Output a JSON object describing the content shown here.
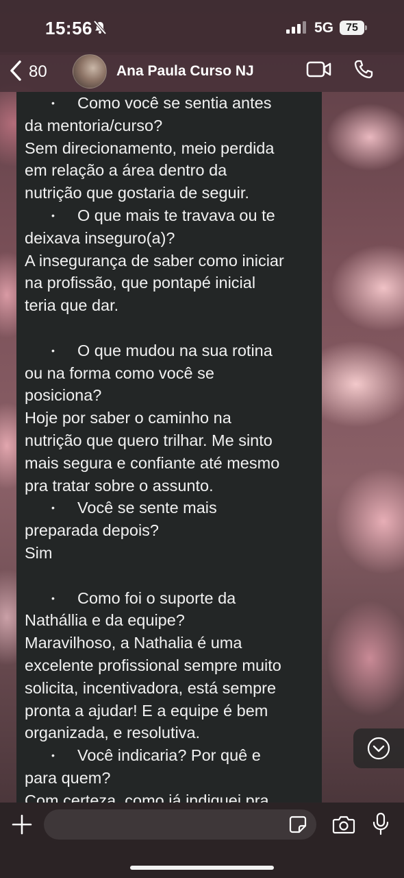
{
  "status_bar": {
    "time": "15:56",
    "network": "5G",
    "battery": "75"
  },
  "header": {
    "back_count": "80",
    "contact_name": "Ana Paula Curso NJ"
  },
  "message": {
    "lines": [
      {
        "type": "bullet",
        "text": "Como você se sentia antes"
      },
      {
        "type": "text",
        "text": "da mentoria/curso?"
      },
      {
        "type": "text",
        "text": "Sem direcionamento, meio perdida"
      },
      {
        "type": "text",
        "text": "em relação a área dentro da"
      },
      {
        "type": "text",
        "text": "nutrição que gostaria de seguir."
      },
      {
        "type": "bullet",
        "text": "O que mais te travava ou te"
      },
      {
        "type": "text",
        "text": "deixava inseguro(a)?"
      },
      {
        "type": "text",
        "text": "A insegurança de saber como iniciar"
      },
      {
        "type": "text",
        "text": "na profissão, que pontapé inicial"
      },
      {
        "type": "text",
        "text": "teria que dar."
      },
      {
        "type": "blank",
        "text": ""
      },
      {
        "type": "bullet",
        "text": "O que mudou na sua rotina"
      },
      {
        "type": "text",
        "text": "ou na forma como você se"
      },
      {
        "type": "text",
        "text": "posiciona?"
      },
      {
        "type": "text",
        "text": "Hoje por saber o caminho na"
      },
      {
        "type": "text",
        "text": "nutrição que quero trilhar. Me sinto"
      },
      {
        "type": "text",
        "text": "mais segura e confiante até mesmo"
      },
      {
        "type": "text",
        "text": "pra tratar sobre o assunto."
      },
      {
        "type": "bullet",
        "text": "Você se sente mais"
      },
      {
        "type": "text",
        "text": "preparada depois?"
      },
      {
        "type": "text",
        "text": "Sim"
      },
      {
        "type": "blank",
        "text": ""
      },
      {
        "type": "bullet",
        "text": "Como foi o suporte da"
      },
      {
        "type": "text",
        "text": "Nathállia e da equipe?"
      },
      {
        "type": "text",
        "text": "Maravilhoso, a Nathalia é uma"
      },
      {
        "type": "text",
        "text": "excelente profissional sempre muito"
      },
      {
        "type": "text",
        "text": "solicita, incentivadora, está sempre"
      },
      {
        "type": "text",
        "text": "pronta a ajudar! E a equipe é bem"
      },
      {
        "type": "text",
        "text": "organizada, e resolutiva."
      },
      {
        "type": "bullet",
        "text": "Você indicaria? Por quê e"
      },
      {
        "type": "text",
        "text": "para quem?"
      },
      {
        "type": "text",
        "text": "Com certeza, como já indiquei pra"
      }
    ]
  },
  "colors": {
    "bubble": "#232626",
    "bar": "#2b2325",
    "composer": "#3e3739"
  },
  "icons": [
    "bell-slash-icon",
    "signal-icon",
    "chevron-left-icon",
    "video-icon",
    "phone-icon",
    "chevron-down-icon",
    "plus-icon",
    "sticker-icon",
    "camera-icon",
    "mic-icon"
  ]
}
